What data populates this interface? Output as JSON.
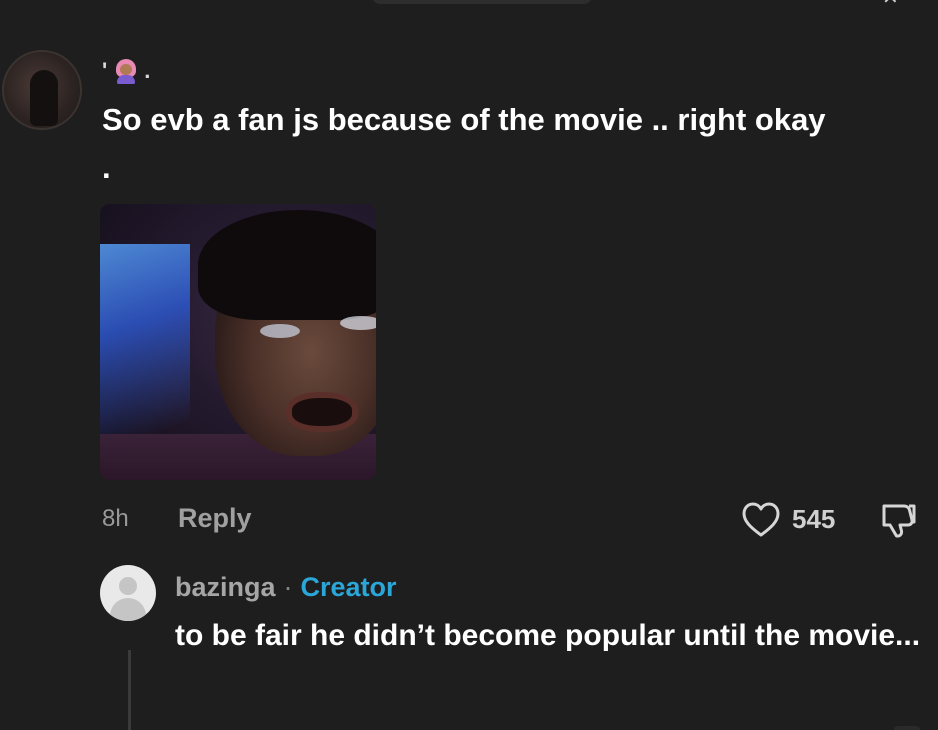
{
  "main_comment": {
    "username_mark": "'",
    "username_emoji": "woman-pink-hair-emoji",
    "username_suffix": ".",
    "text": "So evb a fan js because of the movie .. right okay\n.",
    "time": "8h",
    "reply_label": "Reply",
    "like_count": "545",
    "image_description_icon": "reaction-image"
  },
  "reply_comment": {
    "username": "bazinga",
    "separator": "·",
    "badge": "Creator",
    "text": "to be fair he didn’t become popular until the movie..."
  },
  "colors": {
    "background": "#1e1e1e",
    "creator_badge": "#2aa6d8",
    "text_primary": "#ffffff",
    "text_secondary": "#a0a0a0"
  },
  "icons": [
    "heart-icon",
    "dislike-icon",
    "default-avatar-icon",
    "close-icon"
  ]
}
